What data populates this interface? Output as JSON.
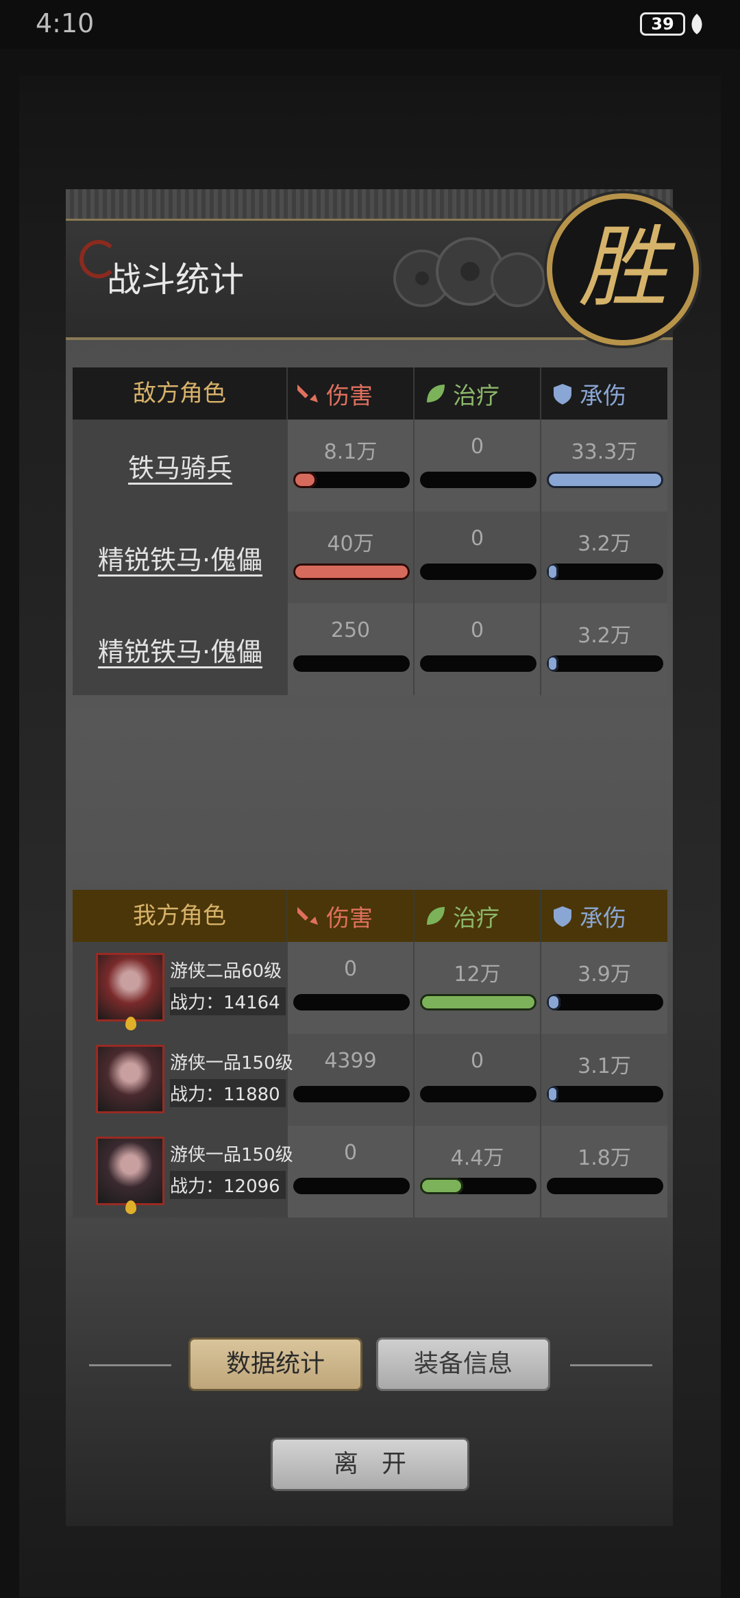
{
  "status_bar": {
    "time": "4:10",
    "battery": "39"
  },
  "header": {
    "title": "战斗统计",
    "victory_glyph": "胜"
  },
  "enemy": {
    "header": {
      "role": "敌方角色",
      "damage": "伤害",
      "healing": "治疗",
      "tanking": "承伤"
    },
    "rows": [
      {
        "name": "铁马骑兵",
        "damage": "8.1万",
        "healing": "0",
        "tanking": "33.3万",
        "damage_fill": 0.2,
        "healing_fill": 0,
        "tanking_fill": 1.0
      },
      {
        "name": "精锐铁马·傀儡",
        "damage": "40万",
        "healing": "0",
        "tanking": "3.2万",
        "damage_fill": 1.0,
        "healing_fill": 0,
        "tanking_fill": 0.1
      },
      {
        "name": "精锐铁马·傀儡",
        "damage": "250",
        "healing": "0",
        "tanking": "3.2万",
        "damage_fill": 0.0,
        "healing_fill": 0,
        "tanking_fill": 0.1
      }
    ]
  },
  "ally": {
    "header": {
      "role": "我方角色",
      "damage": "伤害",
      "healing": "治疗",
      "tanking": "承伤"
    },
    "rows": [
      {
        "name": "游侠二品60级",
        "power": "战力：14164",
        "damage": "0",
        "healing": "12万",
        "tanking": "3.9万",
        "damage_fill": 0,
        "healing_fill": 1.0,
        "tanking_fill": 0.12,
        "avatar_color": "#7a2a2a"
      },
      {
        "name": "游侠一品150级",
        "power": "战力：11880",
        "damage": "4399",
        "healing": "0",
        "tanking": "3.1万",
        "damage_fill": 0.0,
        "healing_fill": 0,
        "tanking_fill": 0.1,
        "avatar_color": "#4a2a2e"
      },
      {
        "name": "游侠一品150级",
        "power": "战力：12096",
        "damage": "0",
        "healing": "4.4万",
        "tanking": "1.8万",
        "damage_fill": 0,
        "healing_fill": 0.37,
        "tanking_fill": 0.0,
        "avatar_color": "#3a2a30"
      }
    ]
  },
  "buttons": {
    "stats": "数据统计",
    "equipment": "装备信息",
    "leave": "离开"
  },
  "colors": {
    "damage": "#e0705e",
    "healing": "#8cb86a",
    "tanking": "#8aa6d4",
    "gold": "#d8b26a"
  }
}
